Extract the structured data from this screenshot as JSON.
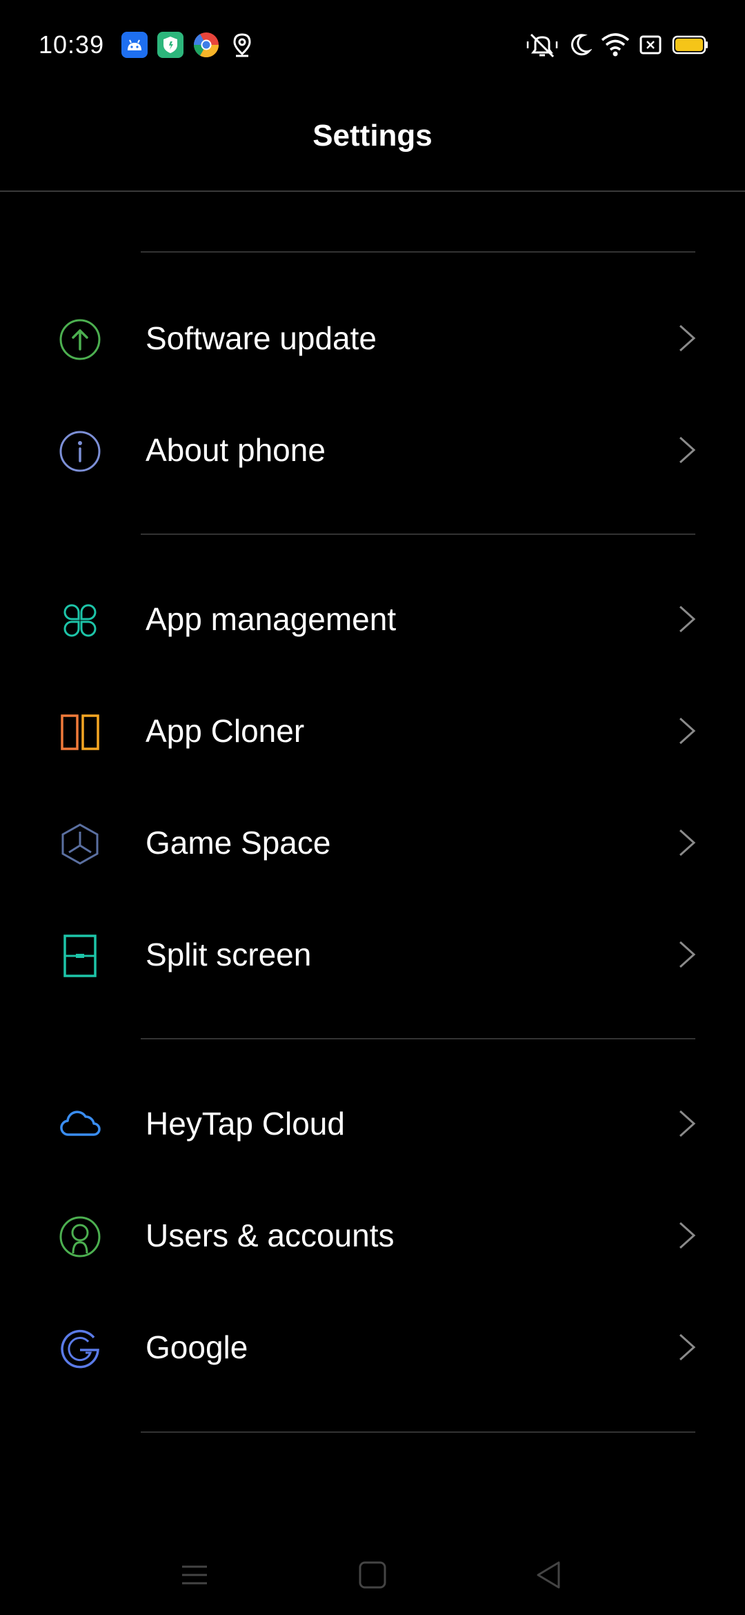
{
  "status_bar": {
    "time": "10:39",
    "left_icons": [
      "android-app-icon",
      "shield-app-icon",
      "chrome-app-icon",
      "location-icon"
    ],
    "right_icons": [
      "vibrate-off-icon",
      "do-not-disturb-moon-icon",
      "wifi-icon",
      "no-sim-icon",
      "battery-icon"
    ],
    "battery_color": "#F5C518"
  },
  "header": {
    "title": "Settings"
  },
  "groups": [
    {
      "items": [
        {
          "label": "Software update",
          "icon": "upload-arrow-icon",
          "color": "#4CAF50"
        },
        {
          "label": "About phone",
          "icon": "info-icon",
          "color": "#7C8FD6"
        }
      ]
    },
    {
      "items": [
        {
          "label": "App management",
          "icon": "apps-grid-icon",
          "color": "#1DC4A8"
        },
        {
          "label": "App Cloner",
          "icon": "app-cloner-icon",
          "color": "#F07A3A"
        },
        {
          "label": "Game Space",
          "icon": "game-space-icon",
          "color": "#5A6FA0"
        },
        {
          "label": "Split screen",
          "icon": "split-screen-icon",
          "color": "#1DC4A8"
        }
      ]
    },
    {
      "items": [
        {
          "label": "HeyTap Cloud",
          "icon": "cloud-icon",
          "color": "#3A8DF0"
        },
        {
          "label": "Users & accounts",
          "icon": "user-icon",
          "color": "#4CAF50"
        },
        {
          "label": "Google",
          "icon": "google-icon",
          "color": "#5B7BE8"
        }
      ]
    }
  ],
  "nav_bar": {
    "buttons": [
      "menu-icon",
      "home-icon",
      "back-icon"
    ]
  }
}
